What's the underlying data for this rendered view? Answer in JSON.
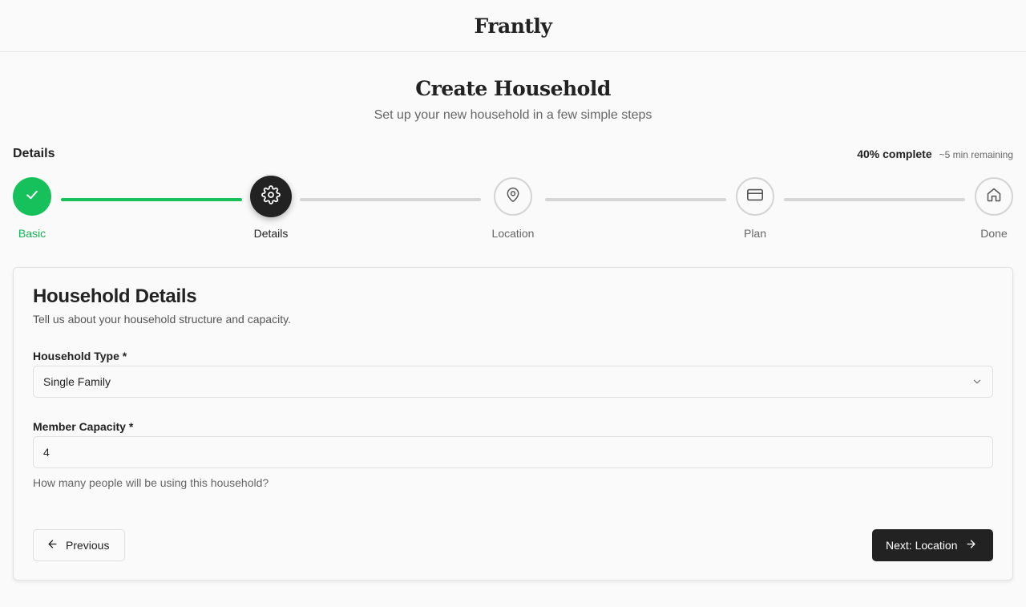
{
  "header": {
    "brand": "Frantly"
  },
  "page": {
    "title": "Create Household",
    "subtitle": "Set up your new household in a few simple steps"
  },
  "progress": {
    "current_step_name": "Details",
    "percent_text": "40% complete",
    "percent_value": 40,
    "remaining_text": "~5 min remaining"
  },
  "steps": [
    {
      "label": "Basic",
      "status": "complete",
      "icon": "check-icon"
    },
    {
      "label": "Details",
      "status": "active",
      "icon": "gear-icon"
    },
    {
      "label": "Location",
      "status": "pending",
      "icon": "map-pin-icon"
    },
    {
      "label": "Plan",
      "status": "pending",
      "icon": "credit-card-icon"
    },
    {
      "label": "Done",
      "status": "pending",
      "icon": "home-icon"
    }
  ],
  "form": {
    "title": "Household Details",
    "description": "Tell us about your household structure and capacity.",
    "household_type": {
      "label": "Household Type *",
      "value": "Single Family"
    },
    "member_capacity": {
      "label": "Member Capacity *",
      "value": "4",
      "help": "How many people will be using this household?"
    }
  },
  "actions": {
    "previous_label": "Previous",
    "next_label": "Next: Location"
  },
  "colors": {
    "success": "#16c05b",
    "primary": "#222222",
    "muted": "#d6d6d6"
  }
}
